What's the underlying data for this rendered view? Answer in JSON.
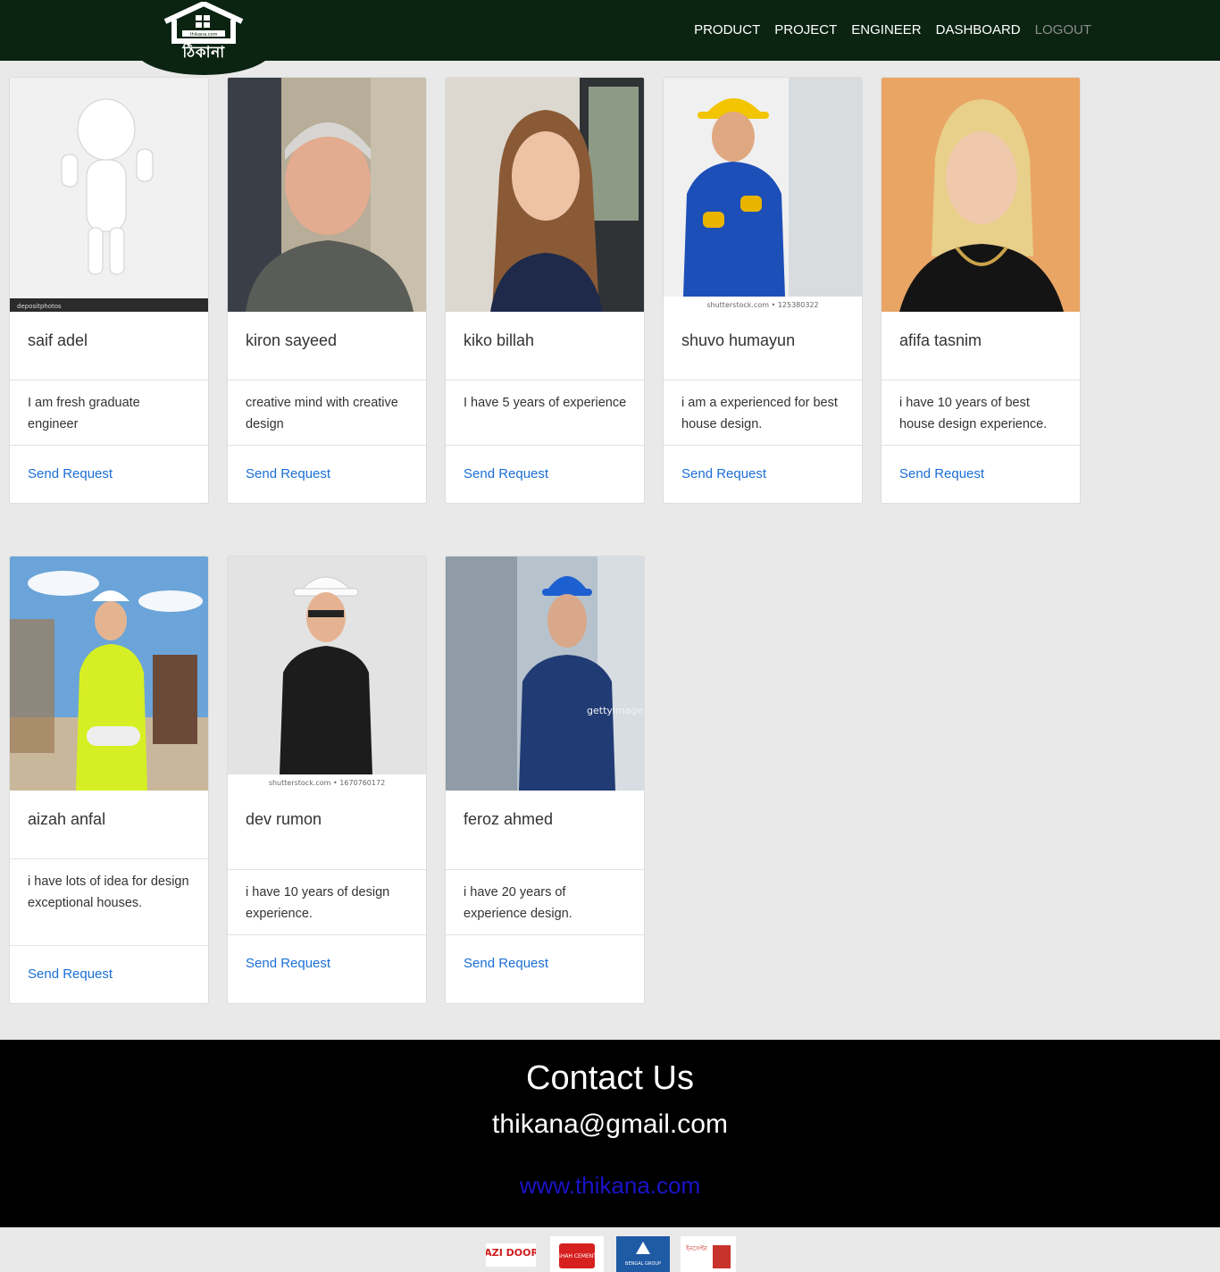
{
  "brand": {
    "logo_text": "ঠিকানা",
    "logo_small": "thikana.com"
  },
  "nav": {
    "items": [
      {
        "label": "PRODUCT"
      },
      {
        "label": "PROJECT"
      },
      {
        "label": "ENGINEER"
      },
      {
        "label": "DASHBOARD"
      },
      {
        "label": "LOGOUT"
      }
    ]
  },
  "engineers": [
    {
      "name": "saif adel",
      "bio": "I am fresh graduate engineer",
      "action": "Send Request",
      "photo_caption": "depositphotos"
    },
    {
      "name": "kiron sayeed",
      "bio": "creative mind with creative design",
      "action": "Send Request"
    },
    {
      "name": "kiko billah",
      "bio": "I have 5 years of experience",
      "action": "Send Request"
    },
    {
      "name": "shuvo humayun",
      "bio": "i am a experienced for best house design.",
      "action": "Send Request",
      "photo_caption": "shutterstock.com • 125380322"
    },
    {
      "name": "afifa tasnim",
      "bio": "i have 10 years of best house design experience.",
      "action": "Send Request"
    },
    {
      "name": "aizah anfal",
      "bio": "i have lots of idea for design exceptional houses.",
      "action": "Send Request"
    },
    {
      "name": "dev rumon",
      "bio": "i have 10 years of design experience.",
      "action": "Send Request",
      "photo_caption": "shutterstock.com • 1670760172"
    },
    {
      "name": "feroz ahmed",
      "bio": "i have 20 years of experience design.",
      "action": "Send Request",
      "photo_caption": "gettyimages"
    }
  ],
  "footer": {
    "heading": "Contact Us",
    "email": "thikana@gmail.com",
    "website": "www.thikana.com"
  },
  "sponsors": [
    {
      "name": "GAZI DOORS"
    },
    {
      "name": "SHAH CEMENT"
    },
    {
      "name": "BENGAL GROUP"
    },
    {
      "name": "ইনসেপ্টা"
    }
  ],
  "colors": {
    "nav_bg": "#0b2412",
    "link": "#1a6fd6",
    "footer_bg": "#000000",
    "website_link": "#1a14c8"
  }
}
